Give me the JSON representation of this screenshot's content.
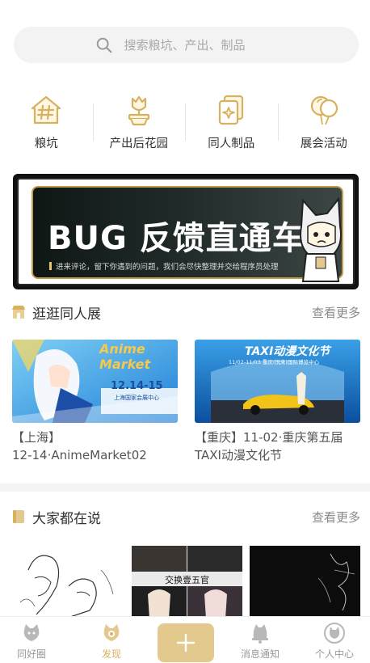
{
  "search": {
    "placeholder": "搜索粮坑、产出、制品",
    "icon": "search-icon"
  },
  "categories": [
    {
      "label": "粮坑",
      "icon": "hash-house-icon"
    },
    {
      "label": "产出后花园",
      "icon": "flower-pot-icon"
    },
    {
      "label": "同人制品",
      "icon": "cards-icon"
    },
    {
      "label": "展会活动",
      "icon": "balloons-icon"
    }
  ],
  "banner": {
    "title": "BUG 反馈直通车",
    "subtitle": "进来评论，留下你遇到的问题，我们会尽快整理并交给程序员处理"
  },
  "section_expo": {
    "title": "逛逛同人展",
    "more": "查看更多",
    "icon": "shop-icon",
    "cards": [
      {
        "line1": "【上海】",
        "line2": "12-14·AnimeMarket02",
        "img_title": "Anime Market",
        "img_date": "12.14-15",
        "img_venue": "上海国家会展中心"
      },
      {
        "line1": "【重庆】11-02·重庆第五届",
        "line2": "TAXI动漫文化节",
        "img_title": "TAXI动漫文化节",
        "img_date": "11/02-11/03 重庆(悦来)国际博览中心"
      }
    ]
  },
  "section_talk": {
    "title": "大家都在说",
    "more": "查看更多",
    "icon": "book-icon",
    "thumb2_label": "交换壹五官"
  },
  "tabbar": {
    "items": [
      {
        "label": "同好圈",
        "icon": "cat-circle-icon"
      },
      {
        "label": "发现",
        "icon": "cat-discover-icon"
      },
      {
        "label": "消息通知",
        "icon": "bell-cat-icon"
      },
      {
        "label": "个人中心",
        "icon": "profile-cat-icon"
      }
    ],
    "active": "发现",
    "center_icon": "plus-icon"
  },
  "colors": {
    "accent": "#d7b25e",
    "plus_bg": "#e3c98e",
    "banner_gold": "#c49b4a"
  }
}
